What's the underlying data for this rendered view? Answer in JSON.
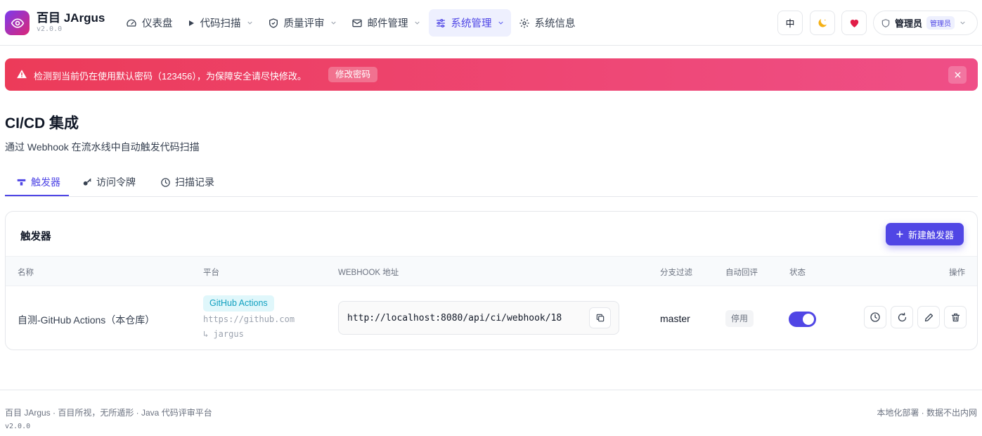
{
  "app": {
    "name": "百目 JArgus",
    "version": "v2.0.0"
  },
  "nav": {
    "items": [
      {
        "label": "仪表盘",
        "icon": "gauge-icon",
        "has_dropdown": false,
        "active": false
      },
      {
        "label": "代码扫描",
        "icon": "play-icon",
        "has_dropdown": true,
        "active": false
      },
      {
        "label": "质量评审",
        "icon": "shield-icon",
        "has_dropdown": true,
        "active": false
      },
      {
        "label": "邮件管理",
        "icon": "mail-icon",
        "has_dropdown": true,
        "active": false
      },
      {
        "label": "系统管理",
        "icon": "sliders-icon",
        "has_dropdown": true,
        "active": true
      },
      {
        "label": "系统信息",
        "icon": "gear-icon",
        "has_dropdown": false,
        "active": false
      }
    ]
  },
  "header": {
    "lang_label": "中",
    "theme_icon": "moon-icon",
    "favorite_icon": "heart-icon",
    "user_name": "管理员",
    "user_role": "管理员"
  },
  "alert": {
    "message": "检测到当前仍在使用默认密码（123456），为保障安全请尽快修改。",
    "action_label": "修改密码"
  },
  "page": {
    "title": "CI/CD 集成",
    "subtitle": "通过 Webhook 在流水线中自动触发代码扫描"
  },
  "tabs": [
    {
      "label": "触发器",
      "icon": "trigger-icon",
      "active": true
    },
    {
      "label": "访问令牌",
      "icon": "key-icon",
      "active": false
    },
    {
      "label": "扫描记录",
      "icon": "clock-icon",
      "active": false
    }
  ],
  "card": {
    "title": "触发器",
    "new_button_label": "新建触发器"
  },
  "table": {
    "columns": [
      "名称",
      "平台",
      "WEBHOOK 地址",
      "分支过滤",
      "自动回评",
      "状态",
      "操作"
    ],
    "rows": [
      {
        "name": "自测-GitHub Actions（本仓库）",
        "platform": "GitHub Actions",
        "repo_url": "https://github.com",
        "repo_name": "↳ jargus",
        "webhook": "http://localhost:8080/api/ci/webhook/18",
        "branch": "master",
        "auto_review": "停用",
        "enabled": true
      }
    ]
  },
  "colors": {
    "accent": "#5046e5",
    "alert_start": "#ec3b59",
    "alert_end": "#ef4f87",
    "badge_cyan": "#0e9fbf"
  },
  "footer": {
    "left": "百目 JArgus · 百目所视，无所遁形 · Java 代码评审平台",
    "version": "v2.0.0",
    "right": "本地化部署 · 数据不出内网"
  }
}
